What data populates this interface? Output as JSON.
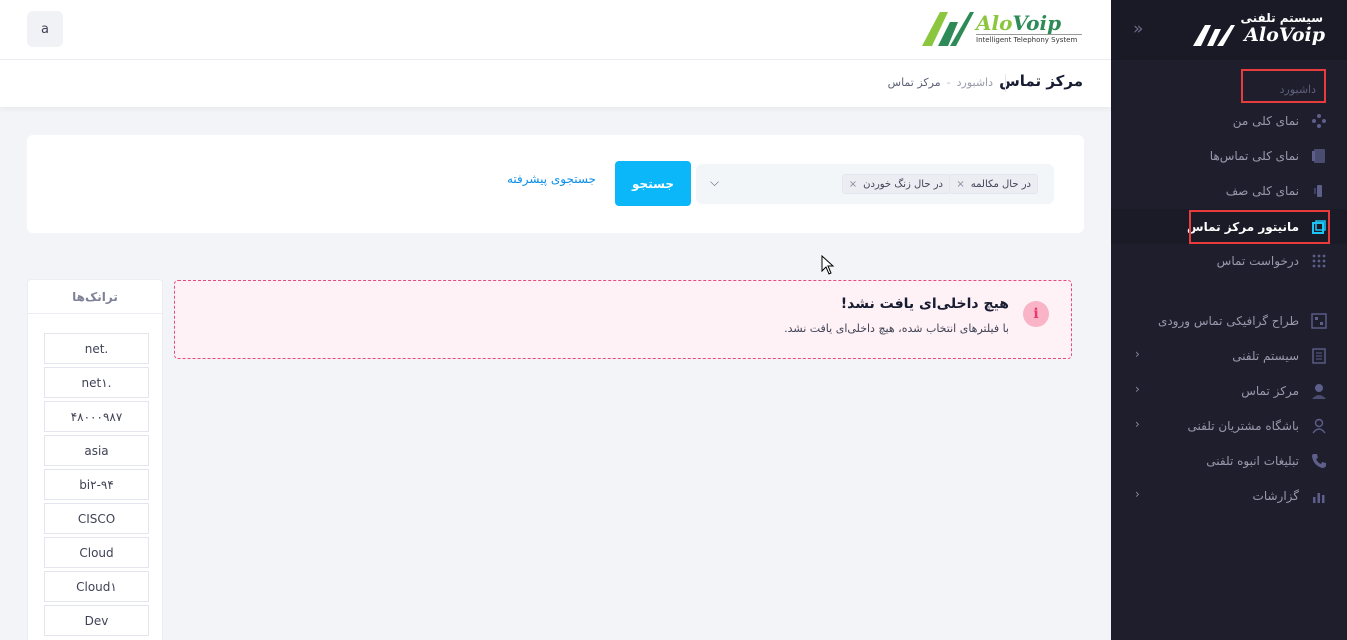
{
  "sidebar": {
    "logo": {
      "system_label": "سیستم تلفنی",
      "brand": "AloVoip"
    },
    "toggle_icon": "double-chevron-right-icon",
    "section_label": "داشبورد",
    "items": [
      {
        "label": "نمای کلی من",
        "icon": "network-icon",
        "active": false
      },
      {
        "label": "نمای کلی تماس‌ها",
        "icon": "phone-book-icon",
        "active": false
      },
      {
        "label": "نمای کلی صف",
        "icon": "queue-icon",
        "active": false
      },
      {
        "label": "مانیتور مرکز تماس",
        "icon": "monitor-icon",
        "active": true
      },
      {
        "label": "درخواست تماس",
        "icon": "dots-grid-icon",
        "active": false
      },
      {
        "label": "طراح گرافیکی تماس ورودی",
        "icon": "flow-designer-icon",
        "active": false
      },
      {
        "label": "سیستم تلفنی",
        "icon": "pbx-icon",
        "active": false,
        "has_submenu": true
      },
      {
        "label": "مرکز تماس",
        "icon": "agent-icon",
        "active": false,
        "has_submenu": true
      },
      {
        "label": "باشگاه مشتریان تلفنی",
        "icon": "customers-icon",
        "active": false,
        "has_submenu": true
      },
      {
        "label": "تبلیغات انبوه تلفنی",
        "icon": "phone-icon",
        "active": false
      },
      {
        "label": "گزارشات",
        "icon": "bar-chart-icon",
        "active": false,
        "has_submenu": true
      }
    ]
  },
  "header": {
    "avatar_letter": "a",
    "logo": {
      "brand_a": "Alo",
      "brand_b": "Voip",
      "tagline": "Intelligent Telephony System"
    }
  },
  "subheader": {
    "title": "مرکز تماس",
    "breadcrumb": {
      "root": "داشبورد",
      "separator": "-",
      "current": "مرکز تماس"
    }
  },
  "filter": {
    "tags": [
      "در حال مکالمه",
      "در حال زنگ خوردن"
    ],
    "search_button": "جستجو",
    "advanced_link": "جستجوی پیشرفته"
  },
  "alert": {
    "icon": "i",
    "title": "هیچ داخلی‌ای یافت نشد!",
    "text": "با فیلترهای انتخاب شده، هیچ داخلی‌ای یافت نشد."
  },
  "trunks": {
    "title": "ترانک‌ها",
    "items": [
      "net.",
      "net۱.",
      "۴۸۰۰۰۹۸۷",
      "asia",
      "bi۲-۹۴",
      "CISCO",
      "Cloud",
      "Cloud۱",
      "Dev"
    ]
  },
  "colors": {
    "primary": "#0bb7f8",
    "sidebar_bg": "#1e1e2d",
    "alert_border": "#e84b7a",
    "highlight_frame": "#e83b3b"
  }
}
